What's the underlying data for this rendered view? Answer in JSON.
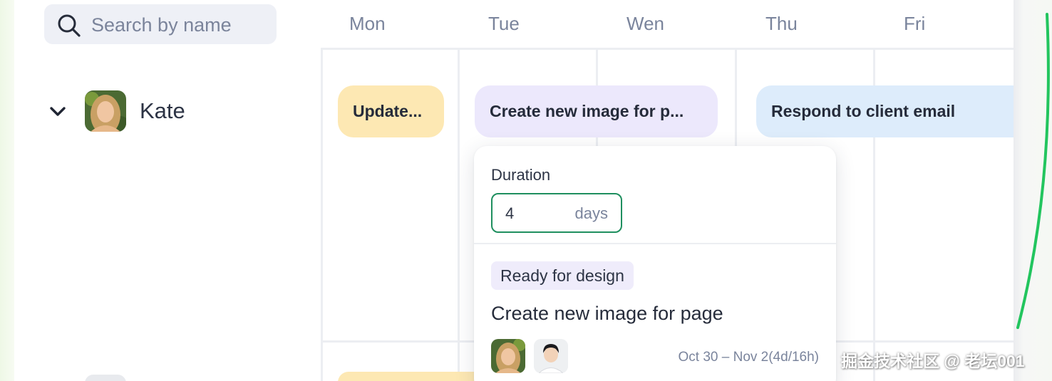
{
  "search": {
    "placeholder": "Search by name",
    "icon": "search-icon"
  },
  "days": [
    "Mon",
    "Tue",
    "Wen",
    "Thu",
    "Fri"
  ],
  "person": {
    "name": "Kate",
    "icon": "chevron-down-icon"
  },
  "tasks": [
    {
      "label": "Update...",
      "color": "#fde8b3"
    },
    {
      "label": "Create new image for p...",
      "color": "#ece8fc"
    },
    {
      "label": "Respond to client email",
      "color": "#ddecfb"
    }
  ],
  "popup": {
    "duration_label": "Duration",
    "duration_value": "4",
    "duration_unit": "days",
    "status": "Ready for design",
    "title": "Create new image for page",
    "date_range": "Oct 30 – Nov 2(4d/16h)"
  },
  "colors": {
    "accent_green": "#1f8f5f",
    "text_dark": "#252b3a",
    "text_muted": "#7a849c"
  },
  "watermark": "掘金技术社区 @ 老坛001"
}
